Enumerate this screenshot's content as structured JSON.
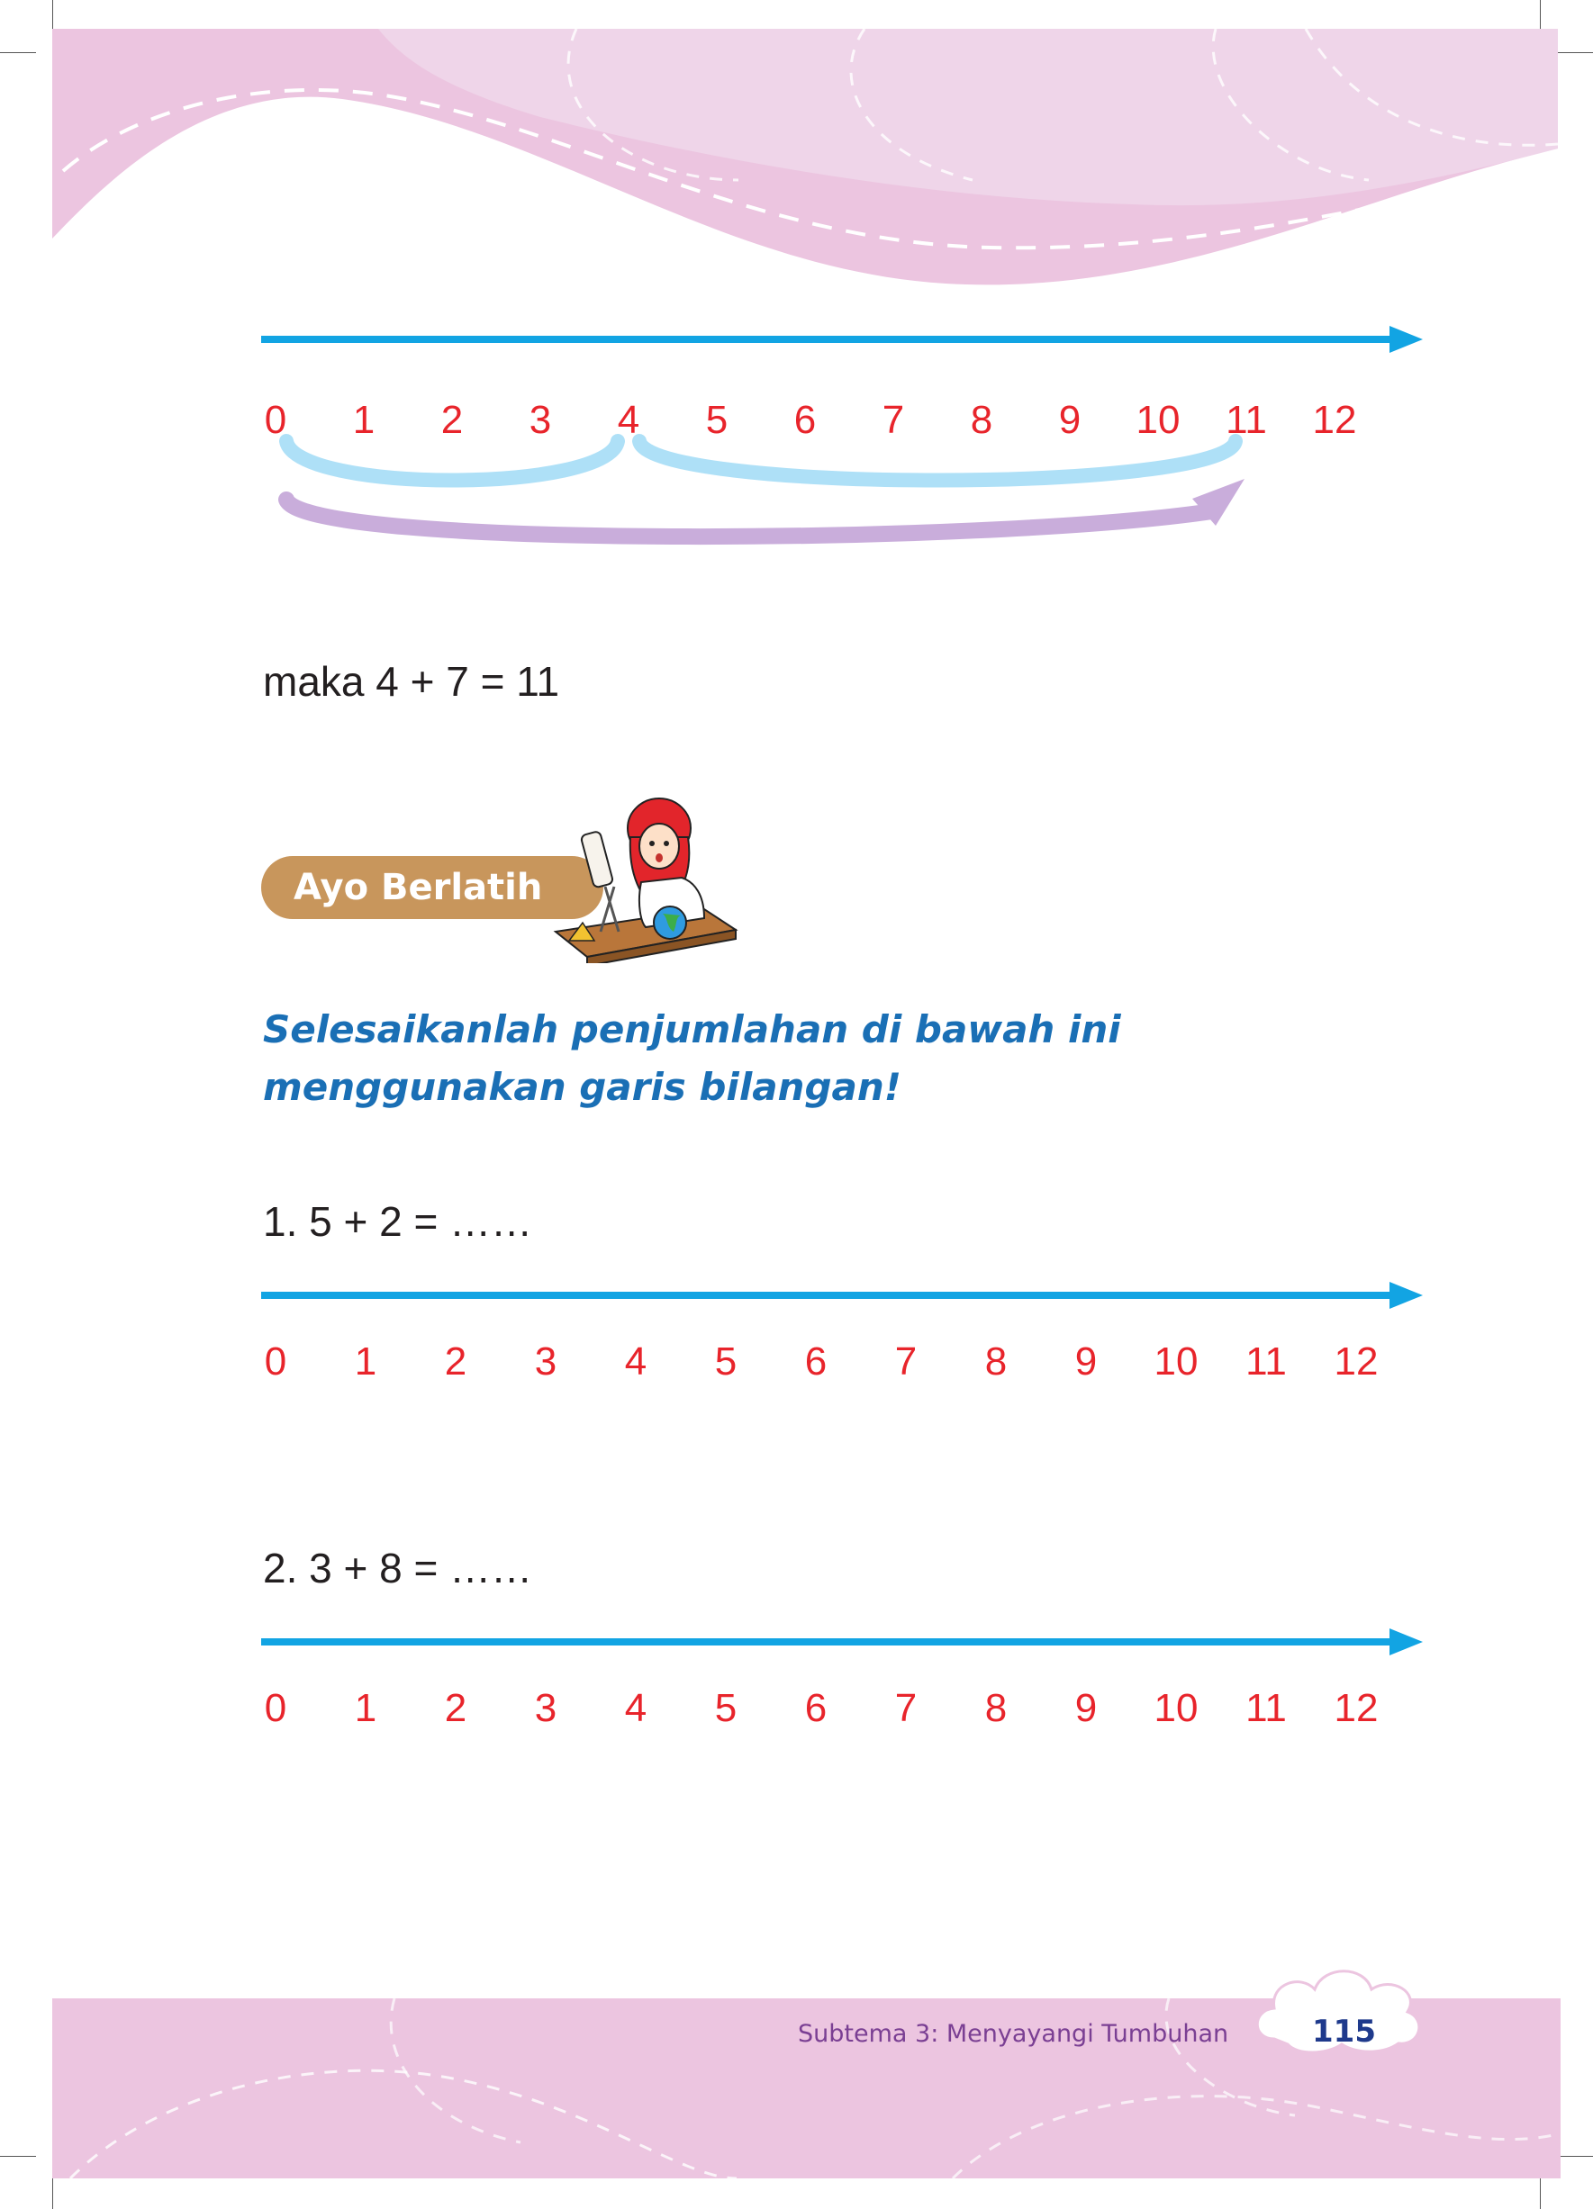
{
  "colors": {
    "accent_blue": "#12a4e3",
    "number_red": "#e8242b",
    "pink_band": "#ecc5e0",
    "light_blue_arc": "#aee0f7",
    "purple_arrow": "#c9addb",
    "badge_brown": "#c8965c",
    "instruction_blue": "#1a6fb5"
  },
  "number_line": {
    "numbers": [
      "0",
      "1",
      "2",
      "3",
      "4",
      "5",
      "6",
      "7",
      "8",
      "9",
      "10",
      "11",
      "12"
    ]
  },
  "example": {
    "jumps": [
      {
        "from": 0,
        "to": 4
      },
      {
        "from": 4,
        "to": 11
      }
    ],
    "total_arrow": {
      "from": 0,
      "to": 11
    },
    "result_text": "maka 4 + 7 = 11"
  },
  "section": {
    "badge_label": "Ayo Berlatih",
    "illustration_icon": "girl-studying-at-desk-icon"
  },
  "instruction": {
    "line1": "Selesaikanlah penjumlahan di bawah ini",
    "line2": "menggunakan garis bilangan!"
  },
  "exercises": [
    {
      "label": "1.  5 + 2 = ……"
    },
    {
      "label": "2.  3 + 8 = ……"
    }
  ],
  "footer": {
    "subtitle": "Subtema 3: Menyayangi Tumbuhan",
    "page_number": "115"
  }
}
